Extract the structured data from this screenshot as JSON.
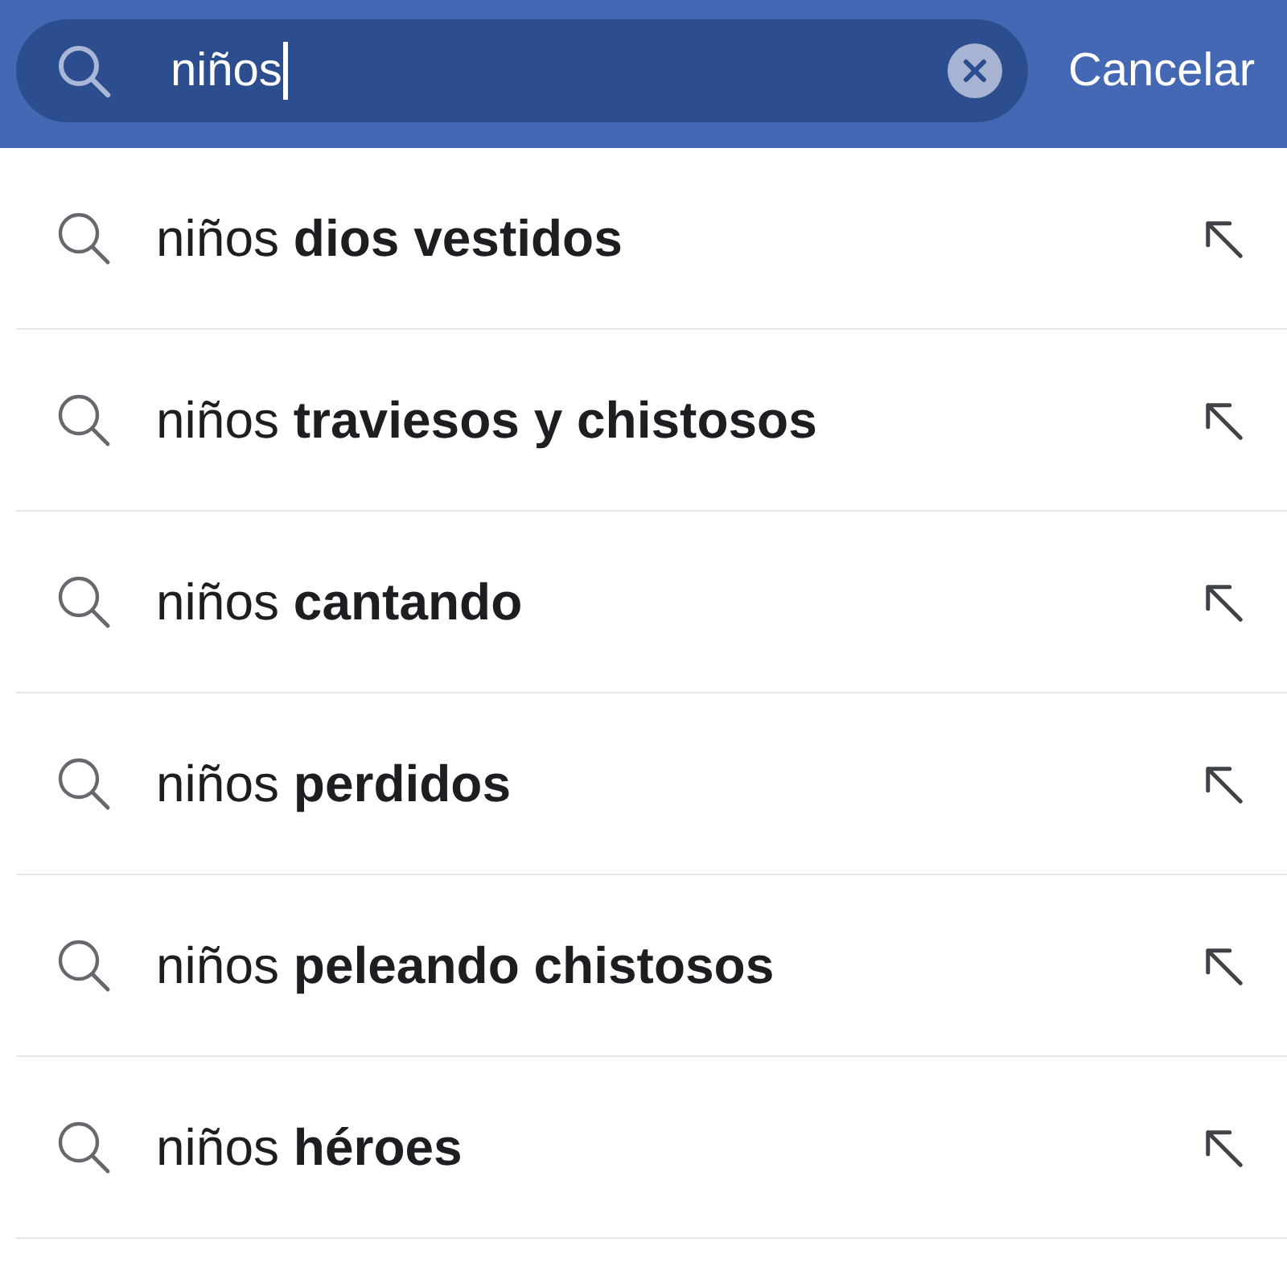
{
  "search": {
    "value": "niños",
    "focused": true,
    "cancel_label": "Cancelar"
  },
  "suggestions": [
    {
      "text": "niños **dios vestidos**"
    },
    {
      "text": "niños **traviesos y chistosos**"
    },
    {
      "text": "niños **cantando**"
    },
    {
      "text": "niños **perdidos**"
    },
    {
      "text": "niños **peleando chistosos**"
    },
    {
      "text": "niños **héroes**"
    }
  ]
}
